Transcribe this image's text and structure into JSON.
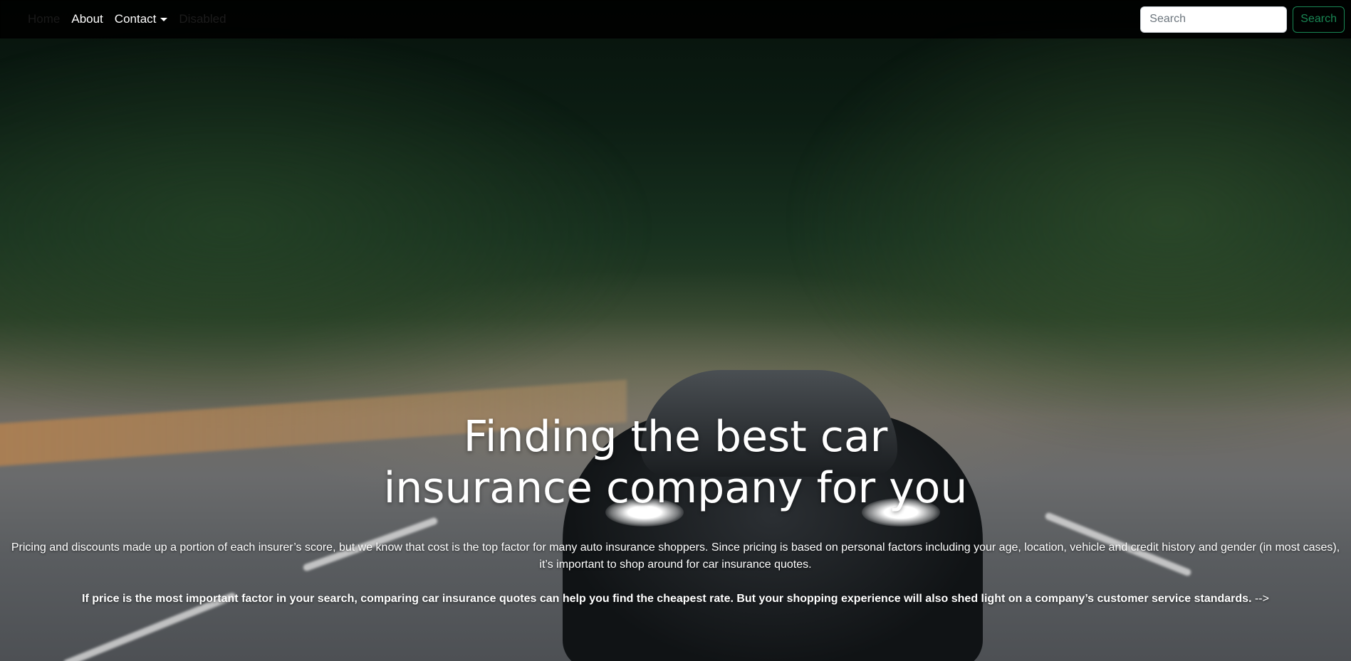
{
  "nav": {
    "brand": "Home",
    "links": [
      {
        "label": "About"
      },
      {
        "label": "Contact"
      }
    ],
    "extra_link": "Disabled",
    "search": {
      "placeholder": "Search",
      "button_label": "Search"
    }
  },
  "hero": {
    "title": "Finding the best car insurance company for you",
    "paragraph": "Pricing and discounts made up a portion of each insurer’s score, but we know that cost is the top factor for many auto insurance shoppers. Since pricing is based on personal factors including your age, location, vehicle and credit history and gender (in most cases), it’s important to shop around for car insurance quotes.",
    "highlight": "If price is the most important factor in your search, comparing car insurance quotes can help you find the cheapest rate. But your shopping experience will also shed light on a company’s customer service standards.",
    "highlight_tail": " -->"
  },
  "colors": {
    "navbar_bg": "#000000",
    "search_button": "#198754",
    "text": "#ffffff"
  }
}
